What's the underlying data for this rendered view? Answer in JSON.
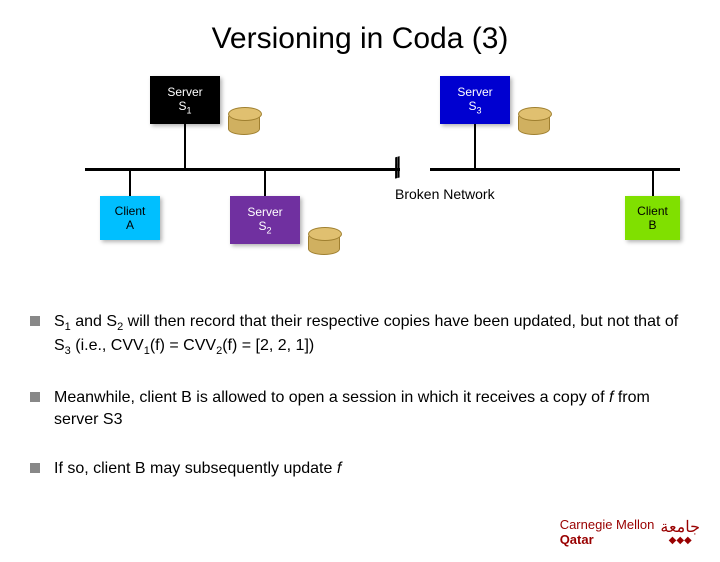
{
  "title": "Versioning in Coda (3)",
  "diagram": {
    "server_s1": "Server",
    "server_s1_sub": "S",
    "server_s1_num": "1",
    "server_s3": "Server",
    "server_s3_sub": "S",
    "server_s3_num": "3",
    "server_s2": "Server",
    "server_s2_sub": "S",
    "server_s2_num": "2",
    "client_a_l1": "Client",
    "client_a_l2": "A",
    "client_b_l1": "Client",
    "client_b_l2": "B",
    "broken_label": "Broken Network"
  },
  "bullets": [
    {
      "pre": "S",
      "sub1": "1",
      "mid1": " and S",
      "sub2": "2",
      "mid2": " will then record that their respective copies have been updated, but not that of S",
      "sub3": "3",
      "mid3": " (i.e., CVV",
      "sub4": "1",
      "mid4": "(f) = CVV",
      "sub5": "2",
      "mid5": "(f) = [2, 2, 1])"
    },
    {
      "text_before": "Meanwhile, client B is allowed to open a session in which it receives a copy of ",
      "italic": "f",
      "text_after": " from server S3"
    },
    {
      "text_before": "If so, client B may subsequently update ",
      "italic": "f",
      "text_after": ""
    }
  ],
  "logo": {
    "line1": "Carnegie Mellon",
    "line2": "Qatar"
  }
}
